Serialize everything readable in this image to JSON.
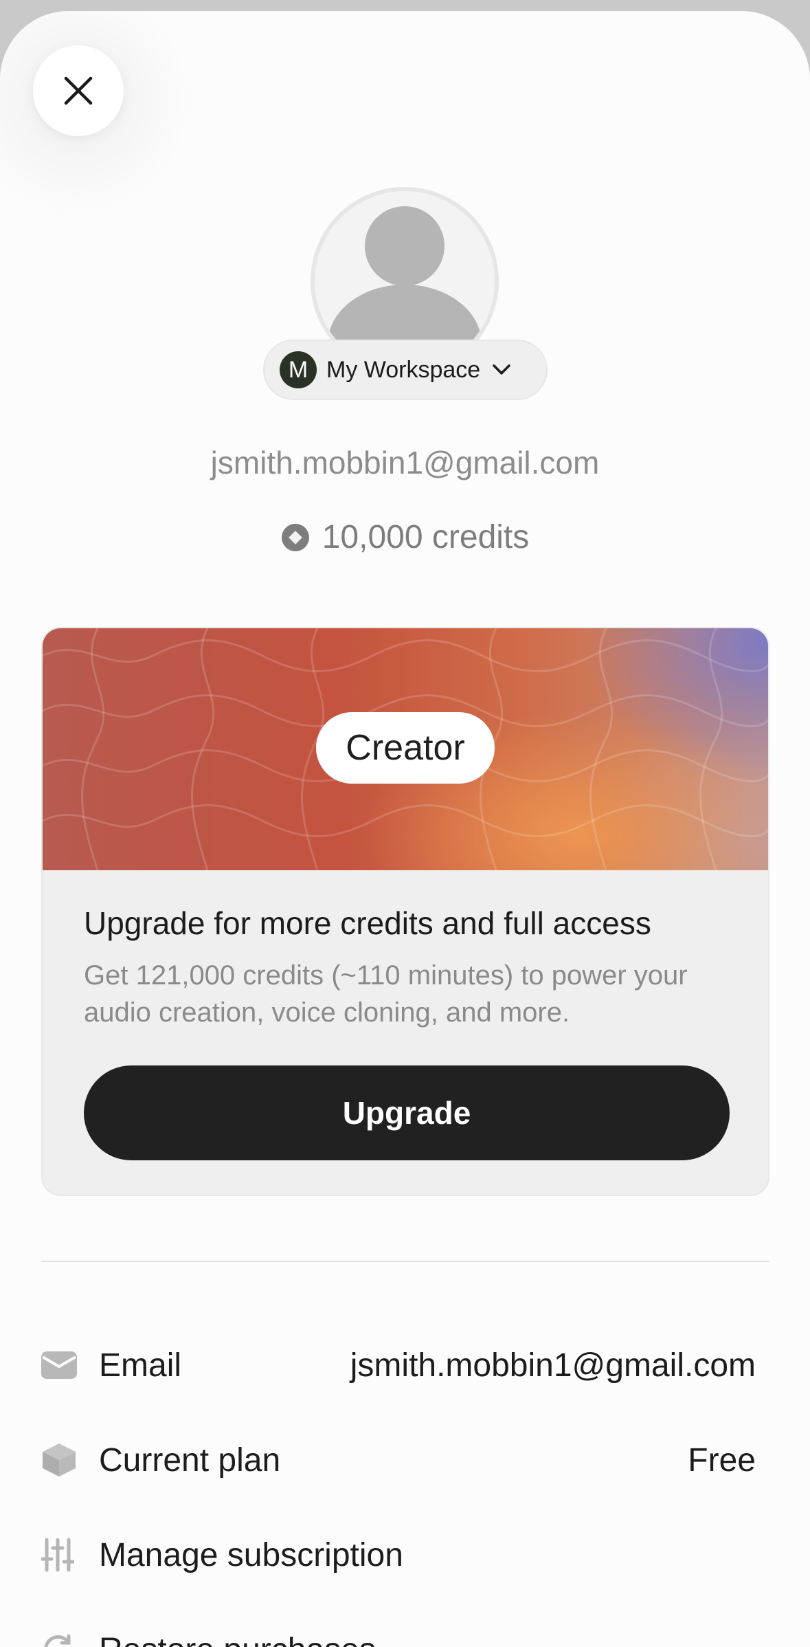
{
  "sheet": {
    "close_icon": "close-icon"
  },
  "profile": {
    "workspace_initial": "M",
    "workspace_name": "My Workspace",
    "email": "jsmith.mobbin1@gmail.com",
    "credits": "10,000 credits"
  },
  "plan_card": {
    "plan_name": "Creator",
    "title": "Upgrade for more credits and full access",
    "description": "Get 121,000 credits (~110 minutes)  to power your audio creation, voice cloning, and more.",
    "button_label": "Upgrade"
  },
  "settings": {
    "items": [
      {
        "label": "Email",
        "value": "jsmith.mobbin1@gmail.com",
        "icon": "envelope-icon"
      },
      {
        "label": "Current plan",
        "value": "Free",
        "icon": "cube-icon"
      },
      {
        "label": "Manage subscription",
        "value": "",
        "icon": "sliders-icon"
      },
      {
        "label": "Restore purchases",
        "value": "",
        "icon": "refresh-icon"
      }
    ]
  },
  "colors": {
    "background": "#fcfcfc",
    "button": "#212121",
    "workspace_badge": "#2a3225"
  }
}
